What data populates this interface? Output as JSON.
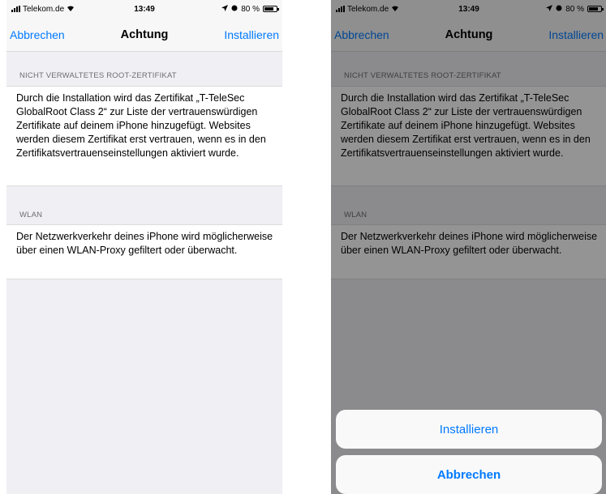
{
  "status": {
    "carrier": "Telekom.de",
    "time": "13:49",
    "battery": "80 %"
  },
  "nav": {
    "cancel": "Abbrechen",
    "title": "Achtung",
    "install": "Installieren"
  },
  "sections": {
    "root_cert_header": "NICHT VERWALTETES ROOT-ZERTIFIKAT",
    "root_cert_text": "Durch die Installation wird das Zertifikat „T-TeleSec GlobalRoot Class 2“ zur Liste der vertrauenswürdigen Zertifikate auf deinem iPhone hinzugefügt. Websites werden diesem Zertifikat erst vertrauen, wenn es in den Zertifikatsvertrauenseinstellungen aktiviert wurde.",
    "wlan_header": "WLAN",
    "wlan_text": "Der Netzwerkverkehr deines iPhone wird möglicherweise über einen WLAN-Proxy gefiltert oder überwacht."
  },
  "action_sheet": {
    "install": "Installieren",
    "cancel": "Abbrechen"
  },
  "colors": {
    "accent": "#007aff",
    "background": "#efeff4",
    "dim_overlay": "rgba(0,0,0,0.42)"
  },
  "icons": [
    "signal-icon",
    "wifi-icon",
    "location-icon",
    "alarm-icon",
    "battery-icon"
  ]
}
